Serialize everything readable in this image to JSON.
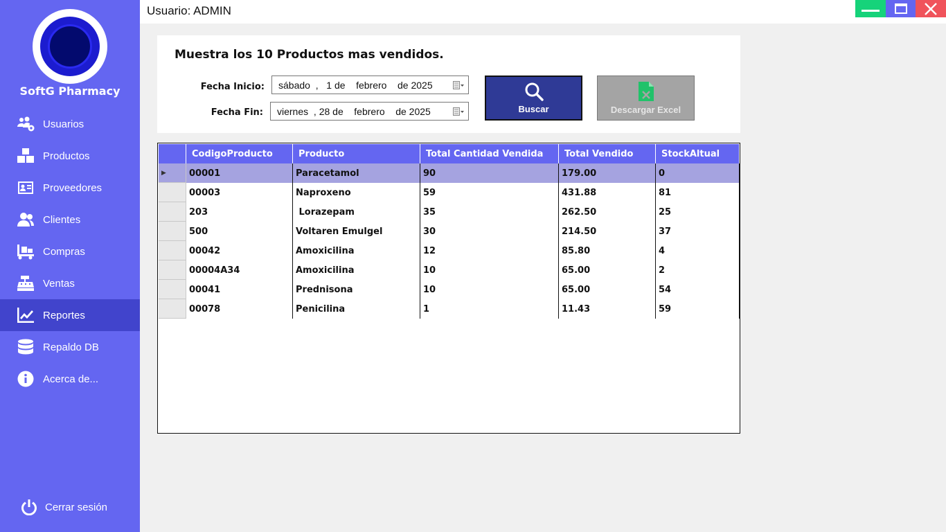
{
  "app": {
    "brand": "SoftG Pharmacy"
  },
  "topbar": {
    "user_label": "Usuario: ADMIN"
  },
  "sidebar": {
    "items": [
      {
        "label": "Usuarios",
        "icon": "users-cog-icon"
      },
      {
        "label": "Productos",
        "icon": "boxes-icon"
      },
      {
        "label": "Proveedores",
        "icon": "id-card-icon"
      },
      {
        "label": "Clientes",
        "icon": "user-group-icon"
      },
      {
        "label": "Compras",
        "icon": "dolly-cart-icon"
      },
      {
        "label": "Ventas",
        "icon": "cash-register-icon"
      },
      {
        "label": "Reportes",
        "icon": "line-chart-icon",
        "active": true
      },
      {
        "label": "Repaldo DB",
        "icon": "database-icon"
      },
      {
        "label": "Acerca de...",
        "icon": "info-icon"
      }
    ],
    "logout_label": "Cerrar sesión"
  },
  "filters": {
    "title": "Muestra los 10 Productos mas vendidos.",
    "start_label": "Fecha Inicio:",
    "start_value": "sábado  ,   1 de    febrero    de 2025",
    "end_label": "Fecha Fin:",
    "end_value": "viernes  , 28 de    febrero    de 2025",
    "search_label": "Buscar",
    "excel_label": "Descargar Excel"
  },
  "grid": {
    "columns": [
      "CodigoProducto",
      "Producto",
      "Total Cantidad Vendida",
      "Total Vendido",
      "StockAltual"
    ],
    "rows": [
      [
        "00001",
        "Paracetamol",
        "90",
        "179.00",
        "0"
      ],
      [
        "00003",
        "Naproxeno",
        "59",
        "431.88",
        "81"
      ],
      [
        "203",
        " Lorazepam",
        "35",
        "262.50",
        "25"
      ],
      [
        "500",
        "Voltaren Emulgel",
        "30",
        "214.50",
        "37"
      ],
      [
        "00042",
        "Amoxicilina",
        "12",
        "85.80",
        "4"
      ],
      [
        "00004A34",
        "Amoxicilina",
        "10",
        "65.00",
        "2"
      ],
      [
        "00041",
        "Prednisona",
        "10",
        "65.00",
        "54"
      ],
      [
        "00078",
        "Penicilina",
        "1",
        "11.43",
        "59"
      ]
    ],
    "selected_row": 0
  },
  "colors": {
    "sidebar": "#6466f1",
    "sidebar_active": "#4144cc",
    "search_button": "#2f3a96",
    "excel_button": "#a4a4a4",
    "selected_row": "#a5a3e0"
  }
}
